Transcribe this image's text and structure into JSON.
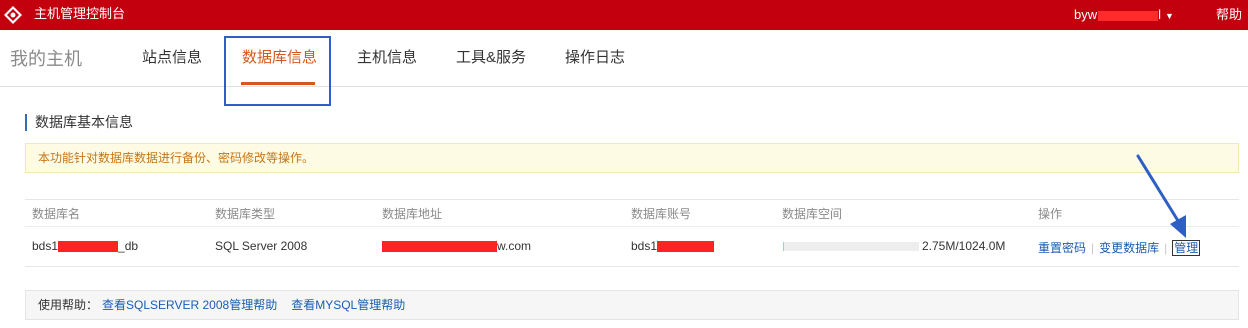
{
  "topbar": {
    "title": "主机管理控制台",
    "user": "byw",
    "user_suffix": "l",
    "help": "帮助"
  },
  "nav": {
    "home": "我的主机",
    "tabs": [
      "站点信息",
      "数据库信息",
      "主机信息",
      "工具&服务",
      "操作日志"
    ],
    "active_index": 1
  },
  "section": {
    "title": "数据库基本信息",
    "notice": "本功能针对数据库数据进行备份、密码修改等操作。"
  },
  "table": {
    "headers": [
      "数据库名",
      "数据库类型",
      "数据库地址",
      "数据库账号",
      "数据库空间",
      "操作"
    ],
    "row": {
      "name_prefix": "bds1",
      "name_suffix": "_db",
      "type": "SQL Server 2008",
      "address_suffix": "w.com",
      "account_prefix": "bds1",
      "space": "2.75M/1024.0M",
      "space_used_fraction": 0.003,
      "actions": [
        "重置密码",
        "变更数据库",
        "管理"
      ]
    }
  },
  "help": {
    "label": "使用帮助：",
    "links": [
      "查看SQLSERVER 2008管理帮助",
      "查看MYSQL管理帮助"
    ]
  },
  "colors": {
    "topbar": "#c3000e",
    "active_tab": "#d5571c",
    "link": "#1a5db0",
    "highlight_box": "#2e5fc4",
    "notice_text": "#c4761a"
  }
}
